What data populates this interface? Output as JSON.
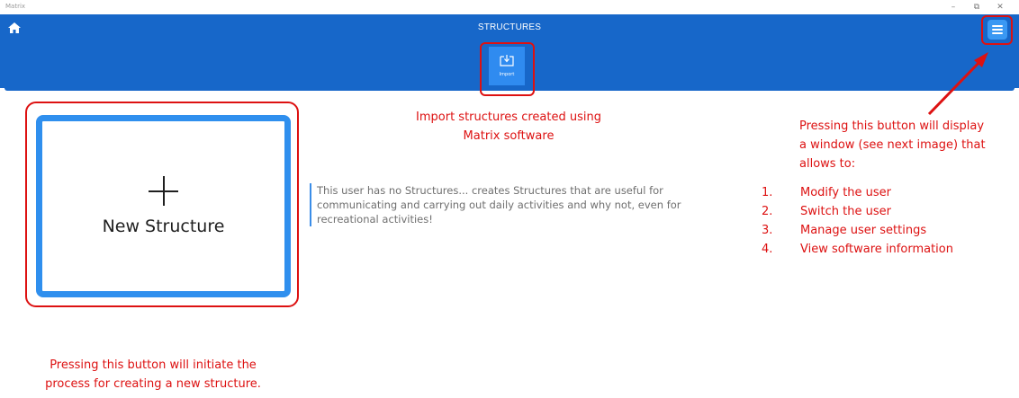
{
  "window": {
    "title": "Matrix",
    "controls": {
      "minimize": "–",
      "maximize": "⧉",
      "close": "✕"
    }
  },
  "header": {
    "title": "STRUCTURES",
    "home_icon": "home-icon",
    "menu_icon": "hamburger-menu-icon",
    "color": "#1767c9"
  },
  "toolbar": {
    "import_label": "Import",
    "import_icon": "import-tray-icon",
    "button_color": "#2f8bf0"
  },
  "main": {
    "new_structure_label": "New Structure",
    "empty_message": "This user has no Structures... creates Structures that are useful for communicating and carrying out daily activities and why not, even for recreational activities!",
    "card_border_color": "#2f8fee"
  },
  "annotations": {
    "color": "#dd1111",
    "import_line1": "Import structures created using",
    "import_line2": "Matrix software",
    "new_structure_line1": "Pressing this button will initiate the",
    "new_structure_line2": "process for creating a new structure.",
    "menu_line1": "Pressing this button will display",
    "menu_line2": "a window (see next image) that",
    "menu_line3": "allows to:",
    "menu_items": [
      {
        "num": "1.",
        "text": "Modify the user"
      },
      {
        "num": "2.",
        "text": "Switch the user"
      },
      {
        "num": "3.",
        "text": "Manage user settings"
      },
      {
        "num": "4.",
        "text": "View software information"
      }
    ]
  }
}
